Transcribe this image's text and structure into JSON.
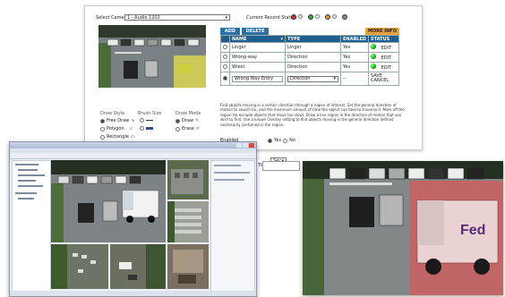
{
  "main_panel": {
    "camera_select_label": "Select Camera:",
    "camera_select_value": "1 - Audio 1201",
    "record_status_label": "Current Record Status:",
    "more_info_label": "MORE INFO",
    "tabs": [
      "ADD",
      "DELETE"
    ],
    "columns": [
      "NAME",
      "TYPE",
      "ENABLED",
      "STATUS"
    ],
    "rules": [
      {
        "name": "Linger",
        "type": "Linger",
        "enabled": "Yes",
        "action": "EDIT"
      },
      {
        "name": "Wrong-way",
        "type": "Direction",
        "enabled": "Yes",
        "action": "EDIT"
      },
      {
        "name": "Wrest",
        "type": "Direction",
        "enabled": "Yes",
        "action": "EDIT"
      },
      {
        "name": "Wrong Way Entry",
        "type": "Direction",
        "enabled": "--",
        "action_save": "SAVE",
        "action_cancel": "CANCEL"
      }
    ],
    "description": "Find objects moving in a certain direction through a region of interest. Set the general direction of motion to search for, and the maximum amount of time the object can take to traverse it. Mark off the region (to exclude objects that move too slow). Draw a line region in the direction of motion that you wish to find. Use a known Overlay setting to find objects moving in the general direction defined necessarily contained in the region.",
    "enabled_label": "Enabled",
    "enabled_yes": "Yes",
    "enabled_no": "No",
    "draw_style_label": "Draw Style",
    "brush_size_label": "Brush Size",
    "draw_mode_label": "Draw Mode",
    "draw_options": [
      "Free Draw",
      "Polygon",
      "Rectangle"
    ],
    "draw_mode_options": [
      "Draw",
      "Erase"
    ],
    "time_label": "Time:",
    "unit_value": "Sec"
  },
  "colors": {
    "header_blue": "#1f5f8f",
    "tab_blue": "#2b6fa4",
    "more_info": "#e6a23a",
    "overlay_yellow": "#e8e24a",
    "overlay_red": "#d65a5a",
    "status_green": "#1aa31a"
  }
}
